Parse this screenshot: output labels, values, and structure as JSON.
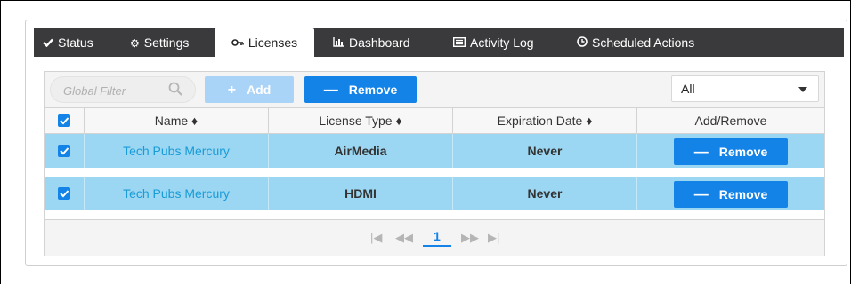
{
  "tabs": [
    {
      "label": "Status",
      "icon": "checkmark-icon"
    },
    {
      "label": "Settings",
      "icon": "gear-icon"
    },
    {
      "label": "Licenses",
      "icon": "key-icon"
    },
    {
      "label": "Dashboard",
      "icon": "bar-chart-icon"
    },
    {
      "label": "Activity Log",
      "icon": "list-icon"
    },
    {
      "label": "Scheduled Actions",
      "icon": "clock-icon"
    }
  ],
  "active_tab": "Licenses",
  "toolbar": {
    "filter_placeholder": "Global Filter",
    "add_label": "Add",
    "remove_label": "Remove",
    "select_value": "All"
  },
  "table": {
    "columns": [
      "Name",
      "License Type",
      "Expiration Date",
      "Add/Remove"
    ],
    "rows": [
      {
        "name": "Tech Pubs Mercury",
        "license_type": "AirMedia",
        "expiration": "Never",
        "action": "Remove"
      },
      {
        "name": "Tech Pubs Mercury",
        "license_type": "HDMI",
        "expiration": "Never",
        "action": "Remove"
      }
    ]
  },
  "pager": {
    "current_page": "1"
  },
  "colors": {
    "accent": "#1383e8",
    "row_selected": "#9bd7f2",
    "tabbar": "#3a3a3c",
    "link": "#1a9bd6"
  }
}
